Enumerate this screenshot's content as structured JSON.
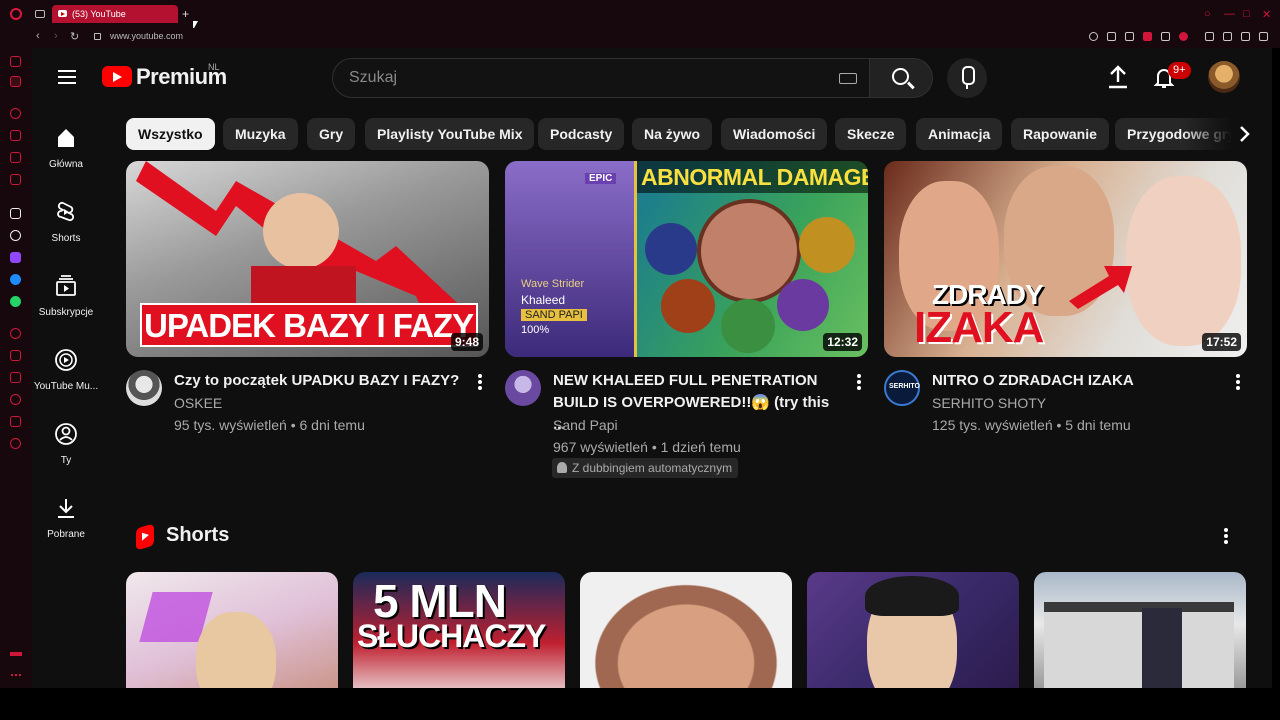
{
  "browser": {
    "tab_title": "(53) YouTube",
    "url": "www.youtube.com"
  },
  "header": {
    "logo_text": "Premium",
    "country_code": "NL",
    "search_placeholder": "Szukaj",
    "notification_count": "9+"
  },
  "guide": [
    {
      "label": "Główna",
      "icon": "home-icon"
    },
    {
      "label": "Shorts",
      "icon": "shorts-icon"
    },
    {
      "label": "Subskrypcje",
      "icon": "subscriptions-icon"
    },
    {
      "label": "YouTube Mu...",
      "icon": "youtube-music-icon"
    },
    {
      "label": "Ty",
      "icon": "user-icon"
    },
    {
      "label": "Pobrane",
      "icon": "download-icon"
    }
  ],
  "chips": [
    "Wszystko",
    "Muzyka",
    "Gry",
    "Playlisty YouTube Mix",
    "Podcasty",
    "Na żywo",
    "Wiadomości",
    "Skecze",
    "Animacja",
    "Rapowanie",
    "Przygodowe gry"
  ],
  "videos": [
    {
      "title": "Czy to początek UPADKU BAZY I FAZY?",
      "channel": "OSKEE",
      "meta": "95 tys. wyświetleń • 6 dni temu",
      "duration": "9:48",
      "thumb_text": "UPADEK BAZY I FAZY"
    },
    {
      "title": "NEW KHALEED FULL PENETRATION BUILD IS OVERPOWERED!!😱 (try this ...",
      "channel": "Sand Papi",
      "meta": "967 wyświetleń • 1 dzień temu",
      "badge": "Z dubbingiem automatycznym",
      "duration": "12:32",
      "thumb_text": "ABNORMAL DAMAGE",
      "thumb_label_epic": "EPIC",
      "thumb_label_strider": "Wave Strider",
      "thumb_label_hero": "Khaleed",
      "thumb_label_papi": "SAND PAPI",
      "thumb_label_pct": "100%"
    },
    {
      "title": "NITRO O ZDRADACH IZAKA",
      "channel": "SERHITO SHOTY",
      "meta": "125 tys. wyświetleń • 5 dni temu",
      "duration": "17:52",
      "thumb_text_1": "ZDRADY",
      "thumb_text_2": "IZAKA",
      "channel_avatar_text": "SERHITO"
    }
  ],
  "shorts": {
    "title": "Shorts",
    "items": [
      {
        "thumb_text": ""
      },
      {
        "thumb_text_1": "5 MLN",
        "thumb_text_2": "SŁUCHACZY"
      },
      {
        "thumb_text": ""
      },
      {
        "thumb_text": ""
      },
      {
        "thumb_text": ""
      }
    ]
  },
  "colors": {
    "brand_red": "#ff0000",
    "opera_red": "#d0163a",
    "bg": "#0f0f0f",
    "chip_bg": "#272727"
  }
}
